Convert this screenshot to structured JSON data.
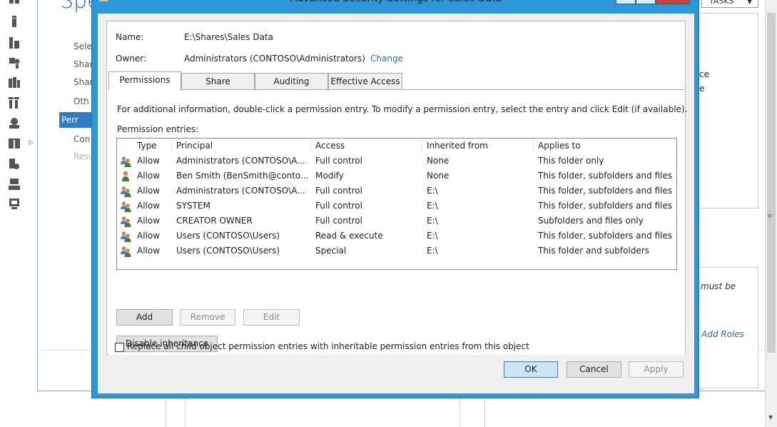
{
  "background": {
    "wizard_title": "Spec",
    "wizard_steps": [
      "Sele",
      "Shar",
      "Shar",
      "Oth",
      "Perr",
      "Con",
      "Resu"
    ],
    "tasks_label": "TASKS",
    "right_fragments": [
      "ce",
      "e"
    ],
    "italic_fragment": "must be",
    "link_fragment": "Add Roles"
  },
  "dialog": {
    "title": "Advanced Security Settings for Sales Data",
    "name_label": "Name:",
    "name_value": "E:\\Shares\\Sales Data",
    "owner_label": "Owner:",
    "owner_value": "Administrators (CONTOSO\\Administrators)",
    "change_link": "Change",
    "tabs": [
      {
        "label": "Permissions",
        "active": true
      },
      {
        "label": "Share",
        "active": false
      },
      {
        "label": "Auditing",
        "active": false
      },
      {
        "label": "Effective Access",
        "active": false
      }
    ],
    "info_text": "For additional information, double-click a permission entry. To modify a permission entry, select the entry and click Edit (if available).",
    "entries_label": "Permission entries:",
    "columns": [
      "Type",
      "Principal",
      "Access",
      "Inherited from",
      "Applies to"
    ],
    "rows": [
      {
        "icon": "group-icon",
        "type": "Allow",
        "principal": "Administrators (CONTOSO\\A...",
        "access": "Full control",
        "inherited": "None",
        "applies": "This folder only"
      },
      {
        "icon": "user-icon",
        "type": "Allow",
        "principal": "Ben Smith (BenSmith@conto...",
        "access": "Modify",
        "inherited": "None",
        "applies": "This folder, subfolders and files"
      },
      {
        "icon": "group-icon",
        "type": "Allow",
        "principal": "Administrators (CONTOSO\\A...",
        "access": "Full control",
        "inherited": "E:\\",
        "applies": "This folder, subfolders and files"
      },
      {
        "icon": "group-icon",
        "type": "Allow",
        "principal": "SYSTEM",
        "access": "Full control",
        "inherited": "E:\\",
        "applies": "This folder, subfolders and files"
      },
      {
        "icon": "group-icon",
        "type": "Allow",
        "principal": "CREATOR OWNER",
        "access": "Full control",
        "inherited": "E:\\",
        "applies": "Subfolders and files only"
      },
      {
        "icon": "group-icon",
        "type": "Allow",
        "principal": "Users (CONTOSO\\Users)",
        "access": "Read & execute",
        "inherited": "E:\\",
        "applies": "This folder, subfolders and files"
      },
      {
        "icon": "group-icon",
        "type": "Allow",
        "principal": "Users (CONTOSO\\Users)",
        "access": "Special",
        "inherited": "E:\\",
        "applies": "This folder and subfolders"
      }
    ],
    "add_button": "Add",
    "remove_button": "Remove",
    "edit_button": "Edit",
    "disable_inheritance_button": "Disable inheritance",
    "replace_checkbox_label": "Replace all child object permission entries with inheritable permission entries from this object",
    "replace_checked": false,
    "ok_button": "OK",
    "cancel_button": "Cancel",
    "apply_button": "Apply"
  },
  "colors": {
    "dialog_frame": "#2e97d8",
    "link": "#1a73c7",
    "wizard_accent": "#2e7dc4"
  }
}
